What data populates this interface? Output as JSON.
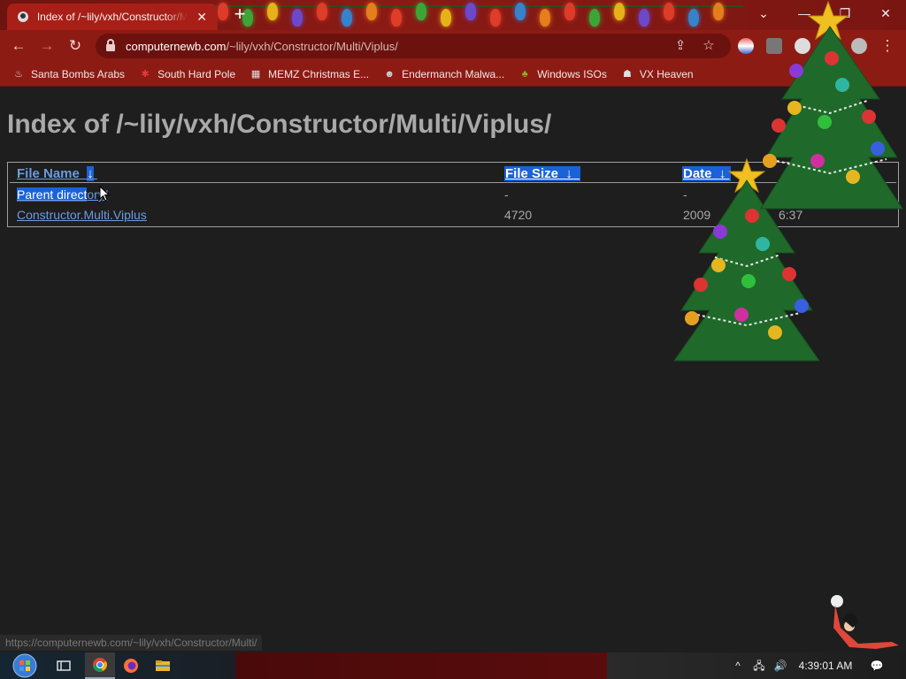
{
  "browser": {
    "tab_title": "Index of /~lily/vxh/Constructor/Multi/Viplus/",
    "tab_close": "✕",
    "new_tab": "+",
    "window": {
      "chevron": "⌄",
      "minimize": "—",
      "maximize": "❐",
      "close": "✕"
    },
    "url_host": "computernewb.com",
    "url_path": "/~lily/vxh/Constructor/Multi/Viplus/",
    "nav": {
      "back": "←",
      "forward": "→",
      "reload": "↻",
      "share": "⇪",
      "star": "☆",
      "menu": "⋮"
    }
  },
  "bookmarks": [
    {
      "label": "Santa Bombs Arabs",
      "icon": "santa-icon",
      "glyph": "♨",
      "color": "#d9d9d9"
    },
    {
      "label": "South Hard Pole",
      "icon": "snowflake-icon",
      "glyph": "✱",
      "color": "#e23b3b"
    },
    {
      "label": "MEMZ Christmas E...",
      "icon": "page-icon",
      "glyph": "▦",
      "color": "#e0e0e0"
    },
    {
      "label": "Endermanch Malwa...",
      "icon": "raccoon-icon",
      "glyph": "☻",
      "color": "#d0d0d0"
    },
    {
      "label": "Windows ISOs",
      "icon": "xmas-tree-icon",
      "glyph": "♣",
      "color": "#8ab32a"
    },
    {
      "label": "VX Heaven",
      "icon": "vx-heaven-icon",
      "glyph": "☗",
      "color": "#e0e0e0"
    }
  ],
  "page": {
    "heading": "Index of /~lily/vxh/Constructor/Multi/Viplus/",
    "columns": [
      {
        "label": "File Name",
        "sort": "↓"
      },
      {
        "label": "File Size",
        "sort": "↓"
      },
      {
        "label": "Date",
        "sort": "↓"
      }
    ],
    "rows": [
      {
        "name_selected": "Parent direct",
        "name_rest": "ory/",
        "size": "-",
        "date": "-"
      },
      {
        "name": "Constructor.Multi.Viplus",
        "size": "4720",
        "date_start": "2009",
        "date_end": "6:37"
      }
    ]
  },
  "status_url": "https://computernewb.com/~lily/vxh/Constructor/Multi/",
  "taskbar": {
    "apps": [
      "start-orb-icon",
      "task-view-icon",
      "chrome-icon",
      "firefox-icon",
      "file-explorer-icon"
    ],
    "tray": {
      "chevron": "^",
      "network": "🖧",
      "volume": "🔊",
      "clock": "4:39:01 AM",
      "notifications": "💬"
    }
  },
  "colors": {
    "chrome_red": "#8c1b14",
    "active_tab": "#a81f18",
    "page_bg": "#1e1e1e",
    "link": "#6b9be0",
    "selection": "#1a62d6",
    "heading": "#a9a9a9"
  }
}
